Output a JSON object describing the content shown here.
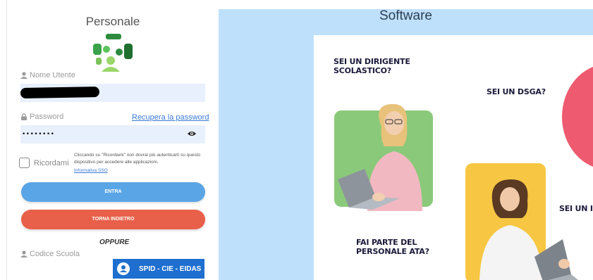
{
  "login": {
    "title": "Personale",
    "username_label": "Nome Utente",
    "password_label": "Password",
    "password_value": "••••••••",
    "recover_link": "Recupera la password",
    "remember_label": "Ricordami",
    "remember_note": "Cliccando su \"Ricordami\" non dovrai più autenticarti su questo dispositivo per accedere alle applicazioni.",
    "sso_link": "Informativa SSO",
    "enter_button": "ENTRA",
    "back_button": "TORNA INDIETRO",
    "or_text": "OPPURE",
    "school_code_label": "Codice Scuola",
    "spid_button": "SPID - CIE - EIDAS"
  },
  "software": {
    "title": "Software",
    "q_dirigente": "SEI UN DIRIGENTE SCOLASTICO?",
    "q_dsga": "SEI UN DSGA?",
    "q_ata": "FAI PARTE DEL PERSONALE ATA?",
    "q_cut": "SEI UN I"
  },
  "colors": {
    "entra": "#5aa5e6",
    "back": "#e8604a",
    "spid": "#1e6fcf",
    "panel_bg": "#bfe0fb"
  },
  "icons": [
    "user-icon",
    "lock-icon",
    "eye-icon",
    "spid-user-icon",
    "logo-icon"
  ]
}
